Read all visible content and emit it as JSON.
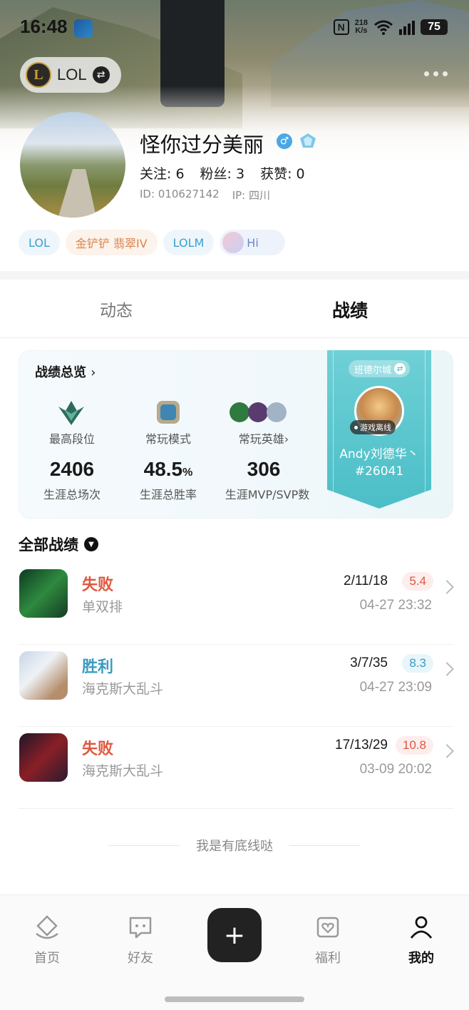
{
  "status_bar": {
    "time": "16:48",
    "net_speed_top": "218",
    "net_speed_unit": "K/s",
    "signal_label": "5A",
    "wifi_label": "6",
    "battery": "75"
  },
  "game_switch": {
    "label": "LOL"
  },
  "profile": {
    "nickname": "怪你过分美丽",
    "following": "关注: 6",
    "fans": "粉丝: 3",
    "likes": "获赞: 0",
    "id": "ID: 010627142",
    "ip": "IP: 四川",
    "tags": [
      "LOL",
      "金铲铲 翡翠IV",
      "LOLM",
      "Hi"
    ]
  },
  "tabs": [
    "动态",
    "战绩"
  ],
  "stats": {
    "title": "战绩总览",
    "highest_rank_label": "最高段位",
    "common_mode_label": "常玩模式",
    "common_heroes_label": "常玩英雄",
    "total_games": "2406",
    "total_games_label": "生涯总场次",
    "win_rate": "48.5",
    "win_rate_unit": "%",
    "win_rate_label": "生涯总胜率",
    "mvp": "306",
    "mvp_label": "生涯MVP/SVP数"
  },
  "summoner": {
    "server": "班德尔城",
    "status": "游戏离线",
    "name": "Andy刘德华丶",
    "tag": "#26041"
  },
  "matches_section": {
    "title": "全部战绩"
  },
  "matches": [
    {
      "result": "失败",
      "mode": "单双排",
      "kda": "2/11/18",
      "score": "5.4",
      "time": "04-27 23:32",
      "outcome": "lose"
    },
    {
      "result": "胜利",
      "mode": "海克斯大乱斗",
      "kda": "3/7/35",
      "score": "8.3",
      "time": "04-27 23:09",
      "outcome": "win"
    },
    {
      "result": "失败",
      "mode": "海克斯大乱斗",
      "kda": "17/13/29",
      "score": "10.8",
      "time": "03-09 20:02",
      "outcome": "lose"
    }
  ],
  "footer_text": "我是有底线哒",
  "nav": {
    "home": "首页",
    "friends": "好友",
    "welfare": "福利",
    "mine": "我的"
  },
  "colors": {
    "lose": "#e0573f",
    "win": "#3b9bc1",
    "banner": "#4bbec7"
  }
}
